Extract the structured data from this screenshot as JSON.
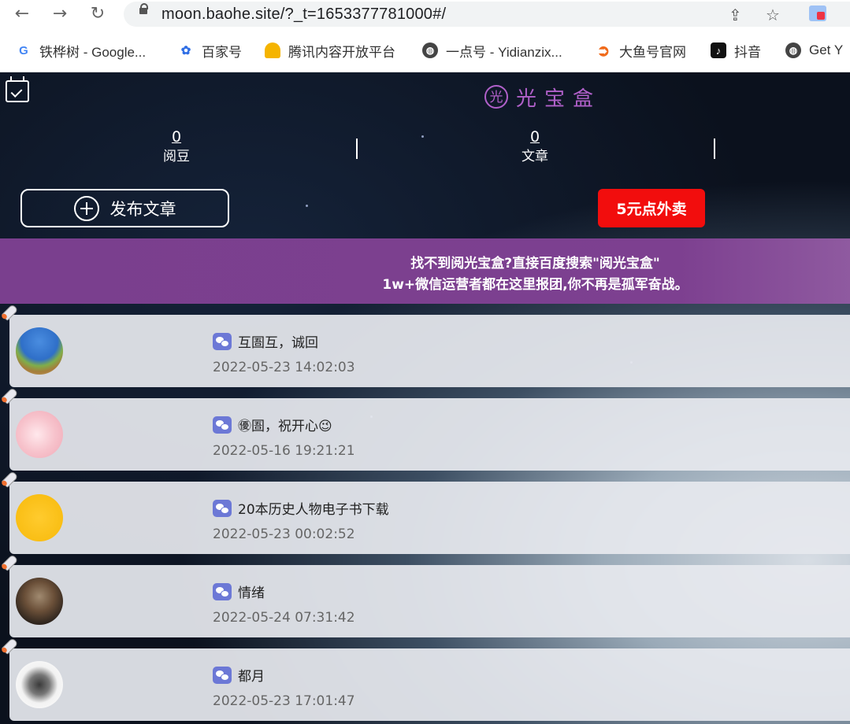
{
  "browser": {
    "url": "moon.baohe.site/?_t=1653377781000#/",
    "bookmarks": [
      {
        "label": "铁桦树 - Google...",
        "icon": "G"
      },
      {
        "label": "百家号",
        "icon": "paw"
      },
      {
        "label": "腾讯内容开放平台",
        "icon": "bell"
      },
      {
        "label": "一点号 - Yidianzix...",
        "icon": "globe"
      },
      {
        "label": "大鱼号官网",
        "icon": "fish"
      },
      {
        "label": "抖音",
        "icon": "tiktok"
      },
      {
        "label": "Get Y",
        "icon": "globe"
      }
    ]
  },
  "header": {
    "logo_mark": "光",
    "logo_text": "光宝盒",
    "stats": [
      {
        "value": "0",
        "label": "阅豆"
      },
      {
        "value": "0",
        "label": "文章"
      }
    ],
    "publish_label": "发布文章",
    "takeout_label": "5元点外卖"
  },
  "banner": {
    "line1": "找不到阅光宝盒?直接百度搜索\"阅光宝盒\"",
    "line2": "1w+微信运营者都在这里报团,你不再是孤军奋战。"
  },
  "articles": [
    {
      "title": "互圄互，诚回",
      "time": "2022-05-23 14:02:03"
    },
    {
      "title": "㊝圄，祝开心😉",
      "time": "2022-05-16 19:21:21"
    },
    {
      "title": "20本历史人物电子书下载",
      "time": "2022-05-23 00:02:52"
    },
    {
      "title": "情绪",
      "time": "2022-05-24 07:31:42"
    },
    {
      "title": "都月",
      "time": "2022-05-23 17:01:47"
    }
  ]
}
